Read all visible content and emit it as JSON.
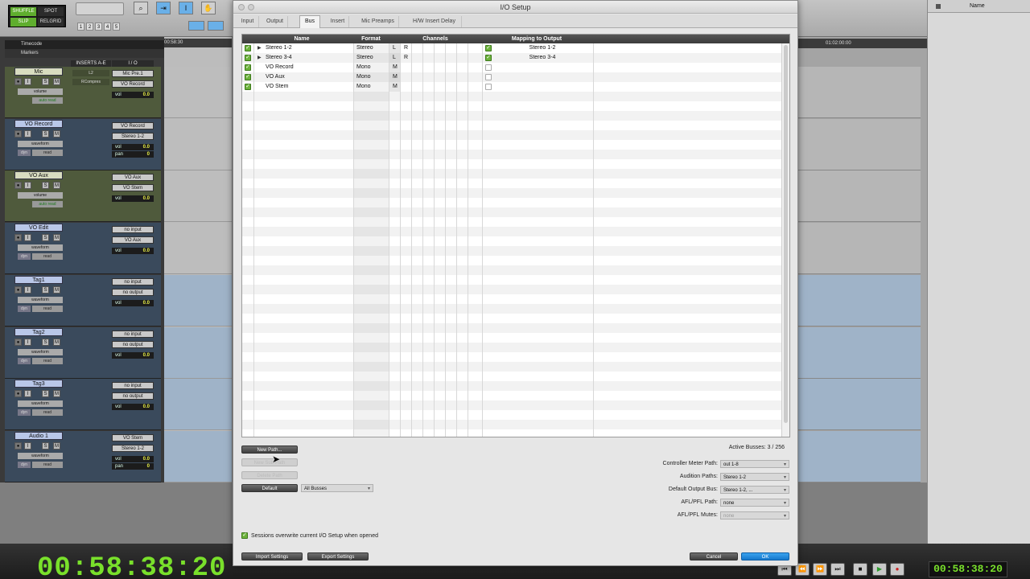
{
  "toolbar": {
    "modes": [
      "SHUFFLE",
      "SPOT",
      "SLIP",
      "GRID"
    ],
    "grid_sub": "RELGRID",
    "nums": [
      "1",
      "2",
      "3",
      "4",
      "5"
    ]
  },
  "rulers": {
    "timecode": "Timecode",
    "markers": "Markers",
    "left_time": "00:58:30",
    "right_time": "01:02:00:00"
  },
  "columns": {
    "inserts": "INSERTS A-E",
    "io": "I / O"
  },
  "tracks": [
    {
      "name": "Mic",
      "kind": "aux",
      "view": "volume",
      "mode": "auto read",
      "ins1": "L2",
      "ins2": "RCompres",
      "in": "Mic Pre.1",
      "out": "VO Record",
      "vol": "0.0"
    },
    {
      "name": "VO Record",
      "kind": "audio",
      "view": "waveform",
      "mode": "read",
      "in": "VO Record",
      "out": "Stereo 1-2",
      "vol": "0.0",
      "pan": "0"
    },
    {
      "name": "VO Aux",
      "kind": "aux",
      "view": "volume",
      "mode": "auto read",
      "in": "VO Aux",
      "out": "VO Stem",
      "vol": "0.0"
    },
    {
      "name": "VO Edit",
      "kind": "audio",
      "view": "waveform",
      "mode": "read",
      "in": "no input",
      "out": "VO Aux",
      "vol": "0.0"
    },
    {
      "name": "Tag1",
      "kind": "audio",
      "view": "waveform",
      "mode": "read",
      "in": "no input",
      "out": "no output",
      "vol": "0.0"
    },
    {
      "name": "Tag2",
      "kind": "audio",
      "view": "waveform",
      "mode": "read",
      "in": "no input",
      "out": "no output",
      "vol": "0.0"
    },
    {
      "name": "Tag3",
      "kind": "audio",
      "view": "waveform",
      "mode": "read",
      "in": "no input",
      "out": "no output",
      "vol": "0.0"
    },
    {
      "name": "Audio 1",
      "kind": "audio",
      "view": "waveform",
      "mode": "read",
      "in": "VO Stem",
      "out": "Stereo 1-2",
      "vol": "0.0",
      "pan": "0"
    }
  ],
  "transport": {
    "big_counter": "00:58:38:20",
    "small_counter": "00:58:38:20"
  },
  "clip_list": {
    "header": "Name"
  },
  "dialog": {
    "title": "I/O Setup",
    "tabs": [
      "Input",
      "Output",
      "Bus",
      "Insert",
      "Mic Preamps",
      "H/W Insert Delay"
    ],
    "active_tab": "Bus",
    "columns": {
      "name": "Name",
      "format": "Format",
      "channels": "Channels",
      "mapping": "Mapping to Output"
    },
    "rows": [
      {
        "name": "Stereo 1-2",
        "expand": "▶",
        "format": "Stereo",
        "ch": [
          "L",
          "R"
        ],
        "mapped": true,
        "map": "Stereo 1-2"
      },
      {
        "name": "Stereo 3-4",
        "expand": "▶",
        "format": "Stereo",
        "ch": [
          "L",
          "R"
        ],
        "mapped": true,
        "map": "Stereo 3-4"
      },
      {
        "name": "VO Record",
        "expand": "",
        "format": "Mono",
        "ch": [
          "M",
          ""
        ],
        "mapped": false,
        "map": ""
      },
      {
        "name": "VO Aux",
        "expand": "",
        "format": "Mono",
        "ch": [
          "M",
          ""
        ],
        "mapped": false,
        "map": ""
      },
      {
        "name": "VO Stem",
        "expand": "",
        "format": "Mono",
        "ch": [
          "M",
          ""
        ],
        "mapped": false,
        "map": ""
      }
    ],
    "active_busses": "Active Busses: 3 / 256",
    "buttons": {
      "new_path": "New Path...",
      "new_sub_path": "New Sub-Path",
      "delete_path": "Delete Path",
      "default": "Default",
      "import": "Import Settings",
      "export": "Export Settings",
      "cancel": "Cancel",
      "ok": "OK"
    },
    "default_select": "All Busses",
    "prefs": [
      {
        "label": "Controller Meter Path:",
        "value": "out 1-8",
        "disabled": false
      },
      {
        "label": "Audition Paths:",
        "value": "Stereo 1-2",
        "disabled": false
      },
      {
        "label": "Default Output Bus:",
        "value": "Stereo 1-2, ...",
        "disabled": false
      },
      {
        "label": "AFL/PFL Path:",
        "value": "none",
        "disabled": false
      },
      {
        "label": "AFL/PFL Mutes:",
        "value": "none",
        "disabled": true
      }
    ],
    "sessions_overwrite": "Sessions overwrite current I/O Setup when opened"
  },
  "colors": {
    "accent_blue": "#1678cc",
    "check_green": "#6cb23b",
    "counter_green": "#79e02b"
  }
}
